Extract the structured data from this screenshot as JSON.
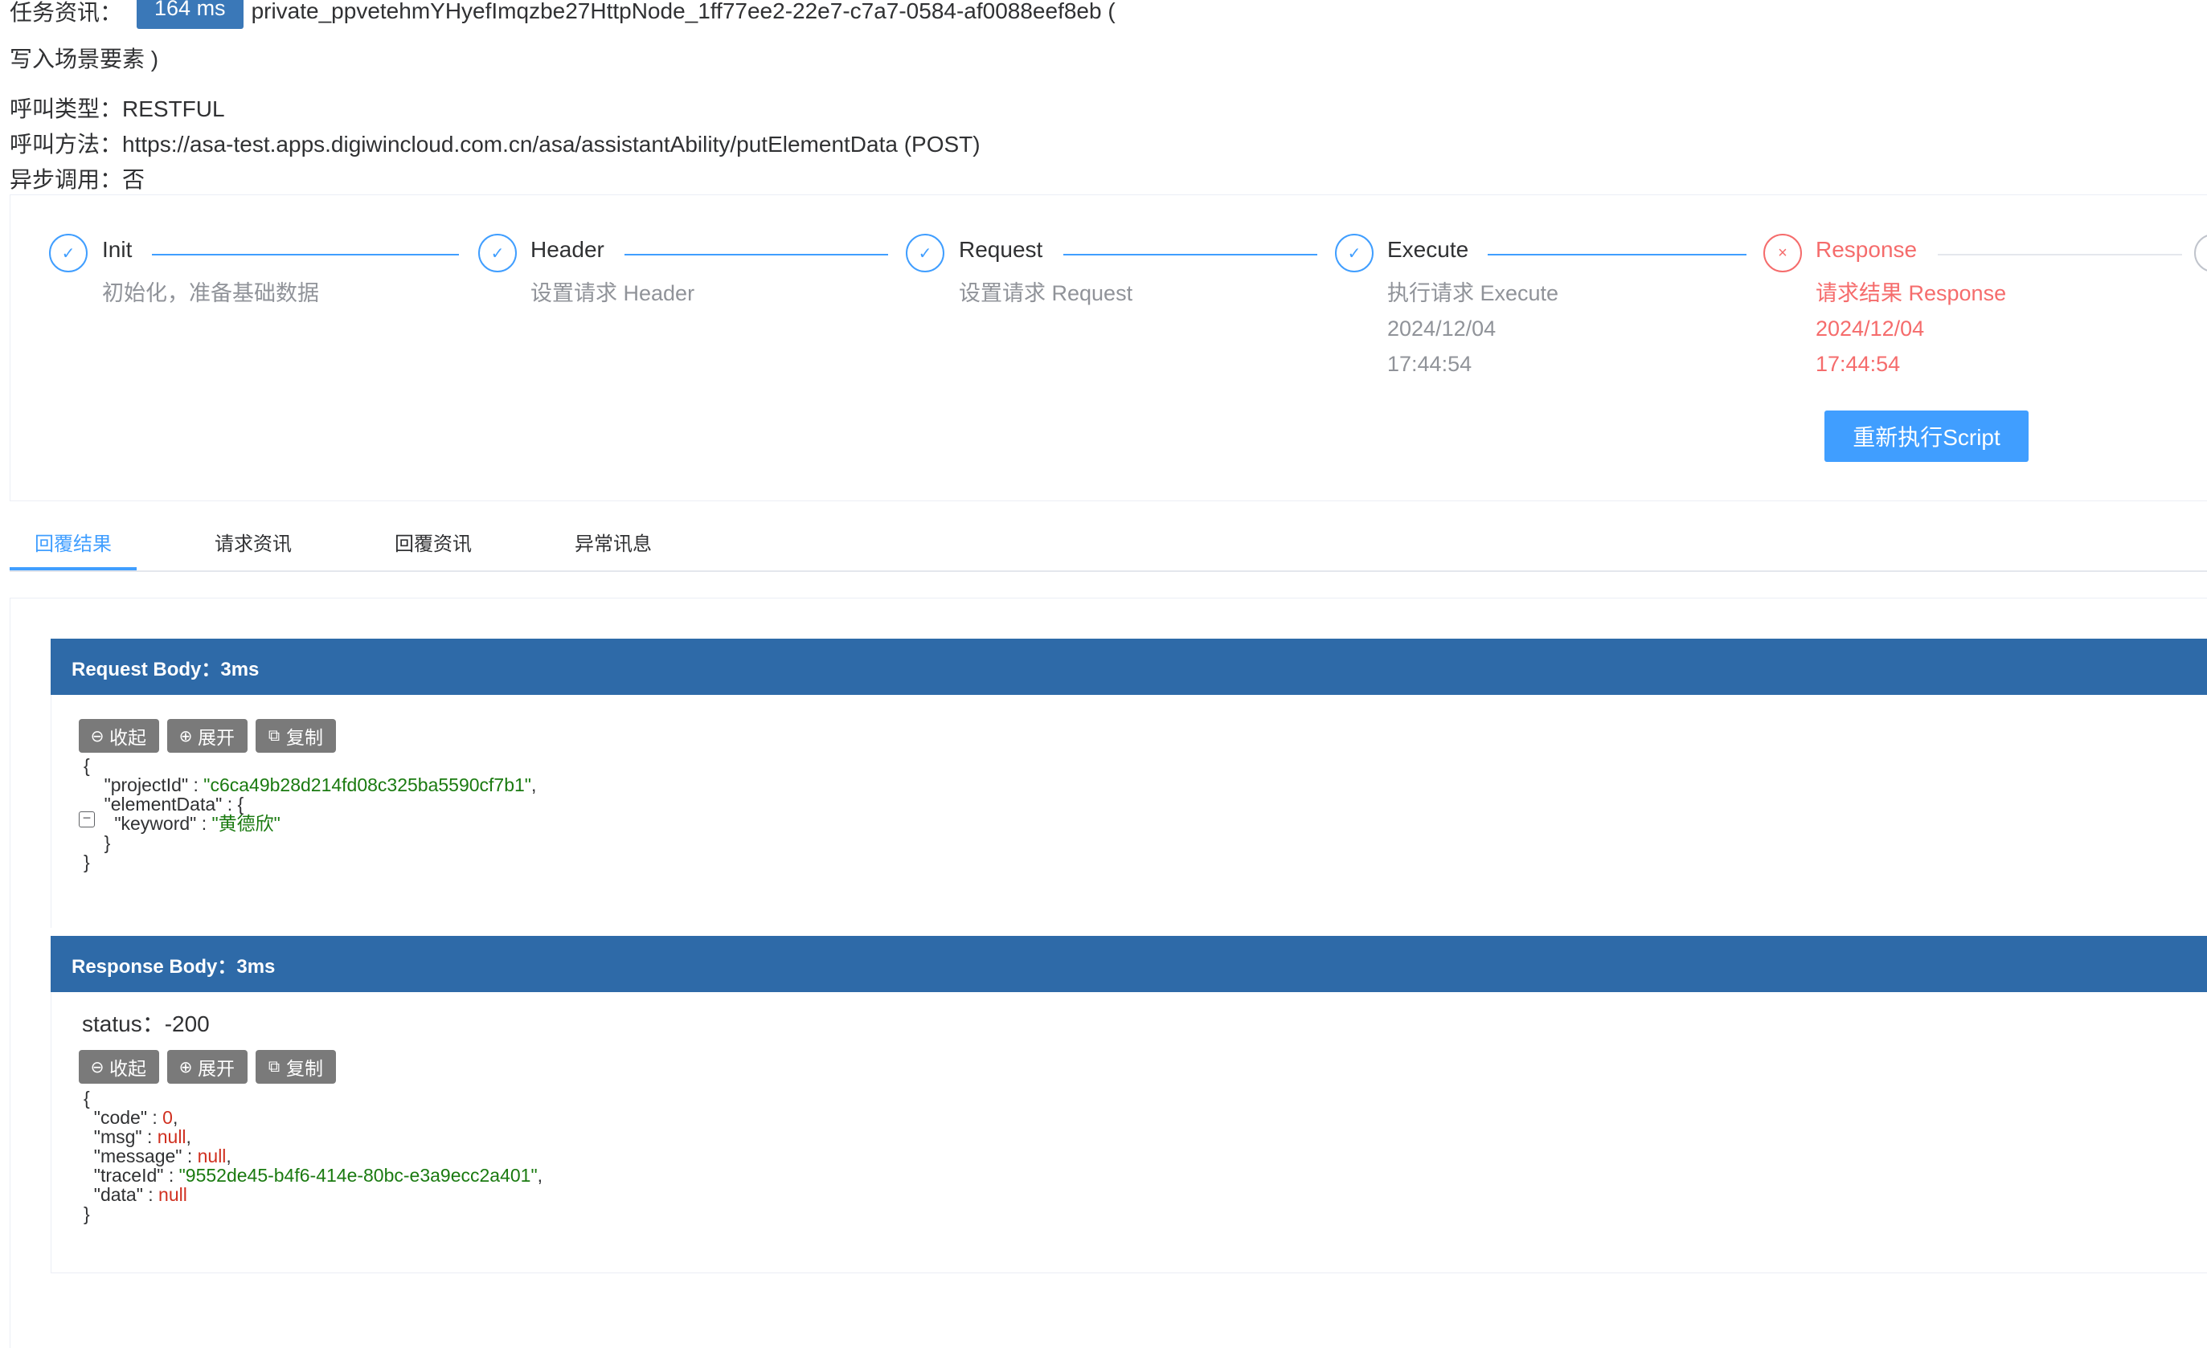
{
  "task_info": {
    "label": "任务资讯：",
    "duration": "164 ms",
    "task_id": "private_ppvetehmYHyefImqzbe27HttpNode_1ff77ee2-22e7-c7a7-0584-af0088eef8eb (",
    "task_name_cont": "写入场景要素 )"
  },
  "call_type": "呼叫类型：RESTFUL",
  "call_method": "呼叫方法：https://asa-test.apps.digiwincloud.com.cn/asa/assistantAbility/putElementData (POST)",
  "async_call": "异步调用：否",
  "steps": [
    {
      "title": "Init",
      "desc": "初始化，准备基础数据",
      "status": "success"
    },
    {
      "title": "Header",
      "desc": "设置请求 Header",
      "status": "success"
    },
    {
      "title": "Request",
      "desc": "设置请求 Request",
      "status": "success"
    },
    {
      "title": "Execute",
      "desc": "执行请求 Execute",
      "date": "2024/12/04",
      "time": "17:44:54",
      "status": "success"
    },
    {
      "title": "Response",
      "desc": "请求结果 Response",
      "date": "2024/12/04",
      "time": "17:44:54",
      "status": "error"
    }
  ],
  "rerun_button": "重新执行Script",
  "tabs": [
    {
      "label": "回覆结果",
      "active": true
    },
    {
      "label": "请求资讯"
    },
    {
      "label": "回覆资讯"
    },
    {
      "label": "异常讯息"
    }
  ],
  "request_section": {
    "header": "Request Body：3ms",
    "buttons": {
      "collapse": "收起",
      "expand": "展开",
      "copy": "复制"
    },
    "json": {
      "open": "{",
      "project_key": "\"projectId\" : ",
      "project_val": "\"c6ca49b28d214fd08c325ba5590cf7b1\"",
      "element_key": "\"elementData\" : {",
      "keyword_key": "\"keyword\" : ",
      "keyword_val": "\"黄德欣\"",
      "inner_close": "}",
      "close": "}"
    }
  },
  "response_section": {
    "header": "Response Body：3ms",
    "status": "status：-200",
    "buttons": {
      "collapse": "收起",
      "expand": "展开",
      "copy": "复制"
    },
    "json": {
      "open": "{",
      "code_key": "\"code\" : ",
      "code_val": "0",
      "msg_key": "\"msg\" : ",
      "msg_val": "null",
      "message_key": "\"message\" : ",
      "message_val": "null",
      "traceid_key": "\"traceId\" : ",
      "traceid_val": "\"9552de45-b4f6-414e-80bc-e3a9ecc2a401\"",
      "data_key": "\"data\" : ",
      "data_val": "null",
      "close": "}"
    }
  },
  "colors": {
    "primary": "#409eff",
    "error": "#f56c6c",
    "section_header": "#2e6aa8",
    "json_string": "#1a7a10",
    "json_literal": "#d03020"
  }
}
